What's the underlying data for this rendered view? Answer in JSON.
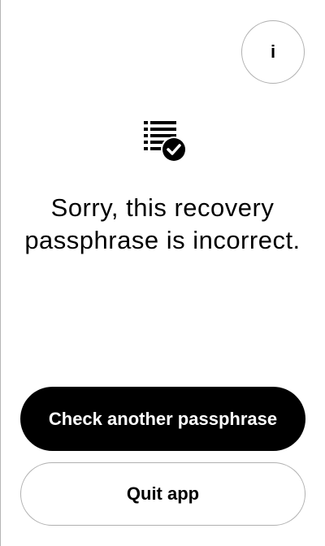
{
  "info_button": {
    "label": "i",
    "icon": "info-icon"
  },
  "status_icon": {
    "icon": "checklist-check-icon"
  },
  "message": {
    "text": "Sorry, this recovery passphrase is incorrect."
  },
  "actions": {
    "primary_label": "Check another passphrase",
    "secondary_label": "Quit app"
  },
  "colors": {
    "background": "#ffffff",
    "primary_button": "#000000",
    "primary_text": "#ffffff",
    "outline": "#b0b0b0",
    "text": "#000000"
  }
}
